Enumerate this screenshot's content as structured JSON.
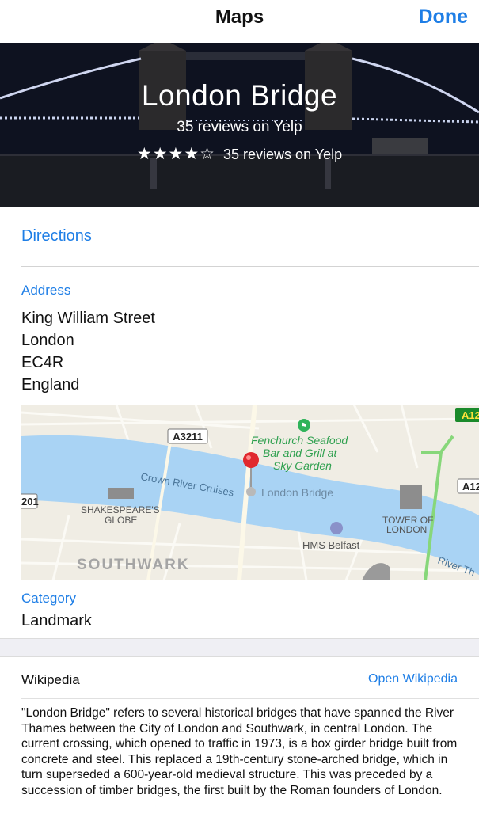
{
  "nav": {
    "title": "Maps",
    "done_label": "Done"
  },
  "hero": {
    "title": "London Bridge",
    "subtitle": "35 reviews on Yelp",
    "stars": "★★★★☆",
    "rating_value": 4,
    "rating_max": 5,
    "reviews": "35 reviews on Yelp"
  },
  "directions": {
    "label": "Directions"
  },
  "address": {
    "label": "Address",
    "lines": [
      "King William Street",
      "London",
      "EC4R",
      "England"
    ]
  },
  "map": {
    "water_color": "#a9d3f4",
    "land_color": "#f0ede4",
    "road_color": "#fdfdfa",
    "pin_color": "#e0282e",
    "road_labels": [
      "A3211",
      "A12",
      "A12",
      "201"
    ],
    "river_label": "Crown River Cruises",
    "river_label_2": "River Th",
    "pin_label": "London Bridge",
    "poi_restaurant": [
      "Fenchurch Seafood",
      "Bar and Grill at",
      "Sky Garden"
    ],
    "poi_globe": [
      "SHAKESPEARE'S",
      "GLOBE"
    ],
    "poi_tower": [
      "TOWER OF",
      "LONDON"
    ],
    "poi_belfast": "HMS Belfast",
    "district": "SOUTHWARK"
  },
  "category": {
    "label": "Category",
    "value": "Landmark"
  },
  "wikipedia": {
    "title": "Wikipedia",
    "link_label": "Open Wikipedia",
    "text": "\"London Bridge\" refers to several historical bridges that have spanned the River Thames between the City of London and Southwark, in central London. The current crossing, which opened to traffic in 1973, is a box girder bridge built from concrete and steel. This replaced a 19th-century stone-arched bridge, which in turn superseded a 600-year-old medieval structure. This was preceded by a succession of timber bridges, the first built by the Roman founders of London."
  }
}
